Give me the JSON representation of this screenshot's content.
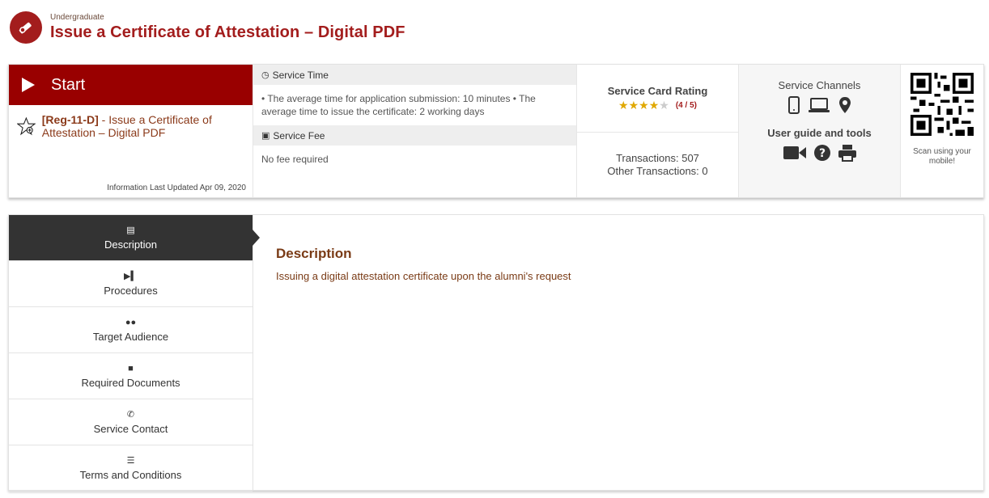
{
  "header": {
    "kicker": "Undergraduate",
    "title": "Issue a Certificate of Attestation – Digital PDF"
  },
  "start": {
    "label": "Start",
    "service_code": "[Reg-11-D]",
    "service_name": " - Issue a Certificate of Attestation – Digital PDF",
    "updated": "Information Last Updated Apr 09, 2020"
  },
  "service_time": {
    "heading": "Service Time",
    "text": "• The average time for application submission: 10 minutes • The average time to issue the certificate: 2 working days"
  },
  "service_fee": {
    "heading": "Service Fee",
    "text": "No fee required"
  },
  "rating": {
    "title": "Service Card Rating",
    "score": "(4 / 5)",
    "value": 4,
    "transactions": "Transactions: 507",
    "other_transactions": "Other Transactions: 0"
  },
  "channels": {
    "title": "Service Channels",
    "icons": [
      "mobile-icon",
      "laptop-icon",
      "location-icon"
    ],
    "guide_title": "User guide and tools",
    "guide_icons": [
      "video-icon",
      "help-icon",
      "print-icon"
    ]
  },
  "qr": {
    "caption": "Scan using your mobile!"
  },
  "tabs": [
    {
      "label": "Description",
      "icon": "file-icon"
    },
    {
      "label": "Procedures",
      "icon": "step-icon"
    },
    {
      "label": "Target Audience",
      "icon": "users-icon"
    },
    {
      "label": "Required Documents",
      "icon": "folder-icon"
    },
    {
      "label": "Service Contact",
      "icon": "phone-icon"
    },
    {
      "label": "Terms and Conditions",
      "icon": "list-icon"
    }
  ],
  "content": {
    "heading": "Description",
    "text": "Issuing a digital attestation certificate upon the alumni's request"
  },
  "colors": {
    "brand": "#990000",
    "accent_text": "#7a3b16",
    "star": "#e0a800"
  }
}
